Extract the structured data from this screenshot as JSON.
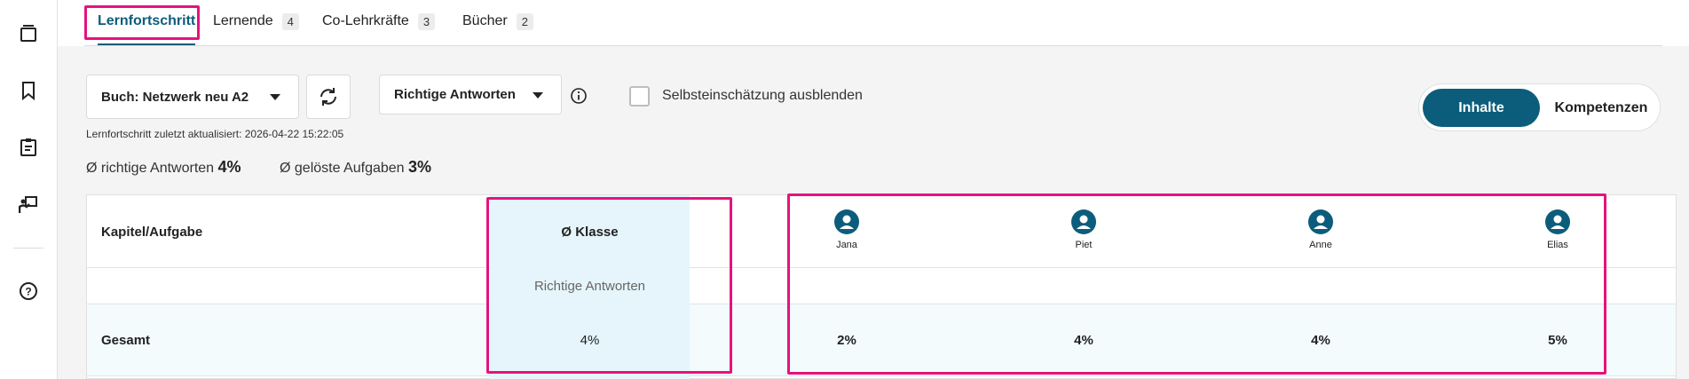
{
  "rail": {
    "icons": [
      "book-stack-icon",
      "bookmark-icon",
      "clipboard-icon",
      "teacher-board-icon",
      "help-icon"
    ]
  },
  "tabs": [
    {
      "label": "Lernfortschritt",
      "count": ""
    },
    {
      "label": "Lernende",
      "count": "4"
    },
    {
      "label": "Co-Lehrkräfte",
      "count": "3"
    },
    {
      "label": "Bücher",
      "count": "2"
    }
  ],
  "controls": {
    "book_select": "Buch: Netzwerk neu A2",
    "metric_select": "Richtige Antworten",
    "self_assessment_label": "Selbsteinschätzung ausblenden",
    "self_assessment_checked": false,
    "updated_text": "Lernfortschritt zuletzt aktualisiert: 2026-04-22 15:22:05",
    "toggle": {
      "active": "Inhalte",
      "inactive": "Kompetenzen"
    }
  },
  "stats": {
    "correct_label": "Ø richtige Antworten",
    "correct_value": "4%",
    "solved_label": "Ø gelöste Aufgaben",
    "solved_value": "3%"
  },
  "table": {
    "first_col_header": "Kapitel/Aufgabe",
    "class_header": "Ø Klasse",
    "subheader": "Richtige Antworten",
    "students": [
      {
        "name": "Jana",
        "value": "2%"
      },
      {
        "name": "Piet",
        "value": "4%"
      },
      {
        "name": "Anne",
        "value": "4%"
      },
      {
        "name": "Elias",
        "value": "5%"
      }
    ],
    "rows": [
      {
        "label": "Gesamt",
        "class_value": "4%"
      }
    ]
  },
  "colors": {
    "accent": "#0c5d7b",
    "highlight": "#e6127e",
    "class_col_bg": "#e5f5fb"
  }
}
